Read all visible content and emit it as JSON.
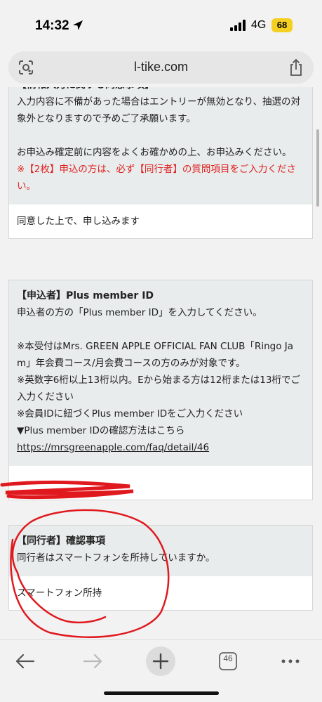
{
  "status_bar": {
    "time": "14:32",
    "network": "4G",
    "battery": "68"
  },
  "browser": {
    "url": "l-tike.com",
    "tabs_count": "46"
  },
  "consent_card": {
    "title": "【情報入力に関する同意事項】",
    "text1": "入力内容に不備があった場合はエントリーが無効となり、抽選の対象外となりますので予めご了承願います。",
    "text2": "お申込み確定前に内容をよくお確かめの上、お申込みください。",
    "warning": "※【2枚】申込の方は、必ず【同行者】の質問項目をご入力ください。",
    "answer": "同意した上で、申し込みます"
  },
  "applicant_card": {
    "title": "【申込者】Plus member ID",
    "text1": "申込者の方の「Plus member ID」を入力してください。",
    "text2": "※本受付はMrs. GREEN APPLE OFFICIAL FAN CLUB「Ringo Jam」年会費コース/月会費コースの方のみが対象です。\n※英数字6桁以上13桁以内。Eから始まる方は12桁または13桁でご入力ください\n※会員IDに紐づくPlus member IDをご入力ください\n▼Plus member IDの確認方法はこちら",
    "link": "https://mrsgreenapple.com/faq/detail/46"
  },
  "companion_card": {
    "title": "【同行者】確認事項",
    "text": "同行者はスマートフォンを所持していますか。",
    "answer": "スマートフォン所持"
  },
  "colors": {
    "warning": "#e02020",
    "battery": "#f5d022",
    "card_head": "#e8ecec",
    "annotation": "#e0191e"
  }
}
